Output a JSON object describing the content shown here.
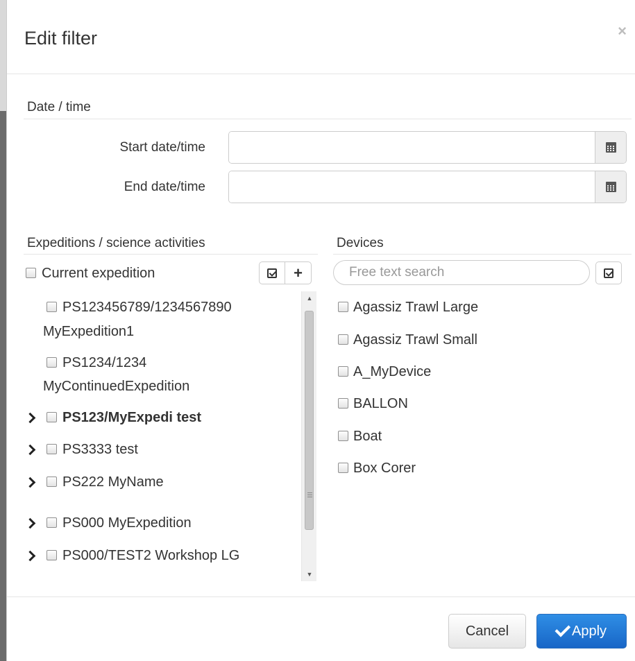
{
  "dialog": {
    "title": "Edit filter",
    "close_symbol": "×"
  },
  "date_time": {
    "section_label": "Date / time",
    "start_label": "Start date/time",
    "start_value": "",
    "end_label": "End date/time",
    "end_value": "",
    "calendar_icon": "calendar-icon"
  },
  "expeditions": {
    "section_label": "Expeditions / science activities",
    "current_expedition_label": "Current expedition",
    "items": [
      {
        "line1": "PS123456789/1234567890",
        "line2": "MyExpedition1",
        "expandable": false,
        "bold": false
      },
      {
        "line1": "PS1234/1234",
        "line2": "MyContinuedExpedition",
        "expandable": false,
        "bold": false
      },
      {
        "line1": "PS123/MyExpedi test",
        "expandable": true,
        "bold": true
      },
      {
        "line1": "PS3333 test",
        "expandable": true,
        "bold": false
      },
      {
        "line1": "PS222 MyName",
        "expandable": true,
        "bold": false
      },
      {
        "line1": "PS000 MyExpedition",
        "expandable": true,
        "bold": false
      },
      {
        "line1": "PS000/TEST2 Workshop LG",
        "expandable": true,
        "bold": false
      }
    ]
  },
  "devices": {
    "section_label": "Devices",
    "search_placeholder": "Free text search",
    "items": [
      "Agassiz Trawl Large",
      "Agassiz Trawl Small",
      "A_MyDevice",
      "BALLON",
      "Boat",
      "Box Corer"
    ]
  },
  "footer": {
    "cancel_label": "Cancel",
    "apply_label": "Apply"
  }
}
